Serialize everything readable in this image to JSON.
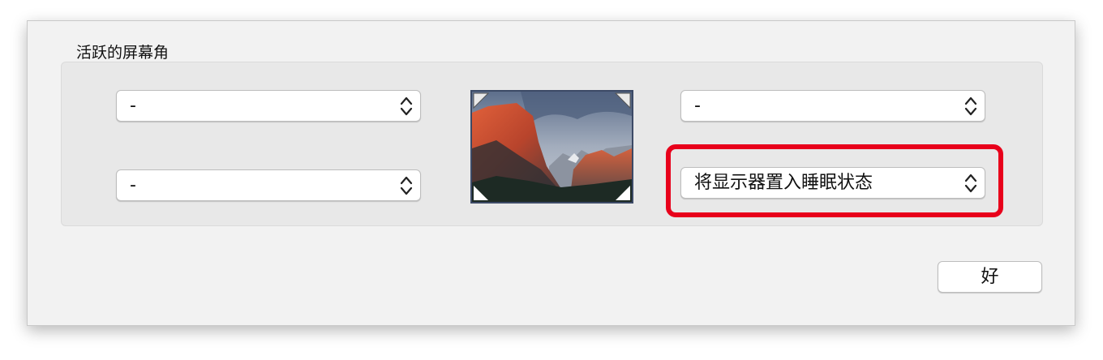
{
  "dialog": {
    "section_title": "活跃的屏幕角"
  },
  "corners": {
    "top_left": {
      "value": "-"
    },
    "bottom_left": {
      "value": "-"
    },
    "top_right": {
      "value": "-"
    },
    "bottom_right": {
      "value": "将显示器置入睡眠状态"
    }
  },
  "preview": {
    "icon": "el-capitan-wallpaper-preview"
  },
  "buttons": {
    "ok_label": "好"
  },
  "colors": {
    "highlight": "#e8001b",
    "group_background": "#e8e8e8",
    "sheet_background": "#f2f2f2"
  }
}
